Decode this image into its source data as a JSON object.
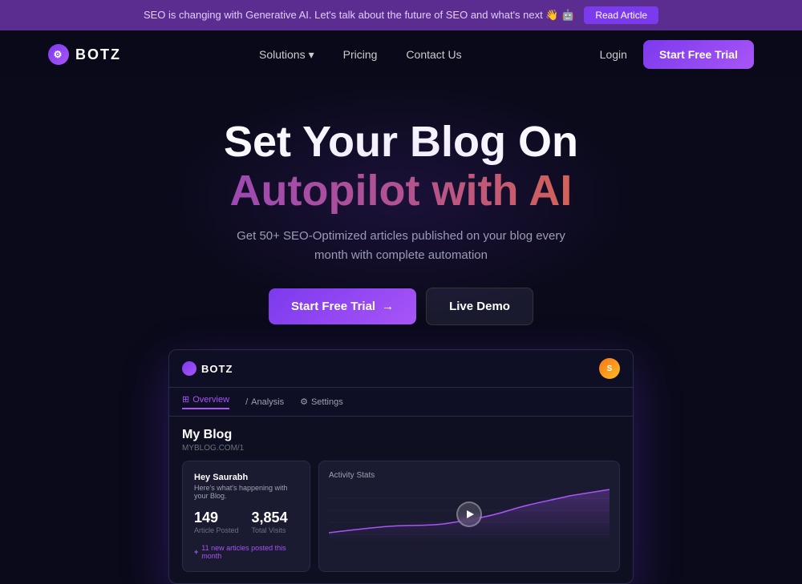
{
  "announcement": {
    "text": "SEO is changing with Generative AI. Let's talk about the future of SEO and what's next 👋 🤖",
    "cta_label": "Read Article"
  },
  "navbar": {
    "logo_text": "BOTZ",
    "nav_links": [
      {
        "label": "Solutions",
        "has_dropdown": true
      },
      {
        "label": "Pricing"
      },
      {
        "label": "Contact Us"
      },
      {
        "label": "Login"
      }
    ],
    "cta_label": "Start Free Trial"
  },
  "hero": {
    "title_line1": "Set Your Blog On",
    "title_line2": "Autopilot with AI",
    "subtitle": "Get 50+ SEO-Optimized articles published on your blog every month with complete automation",
    "btn_primary": "Start Free Trial",
    "btn_secondary": "Live Demo"
  },
  "dashboard": {
    "logo_text": "BOTZ",
    "nav_items": [
      {
        "label": "Overview",
        "active": true
      },
      {
        "label": "Analysis"
      },
      {
        "label": "Settings"
      }
    ],
    "blog_title": "My Blog",
    "blog_url": "MYBLOG.COM/1",
    "greeting": "Hey Saurabh",
    "greeting_desc": "Here's what's happening with your Blog.",
    "articles_posted": "149",
    "articles_label": "Article Posted",
    "total_visits": "3,854",
    "visits_label": "Total Visits",
    "badge_text": "11 new articles posted this month",
    "activity_title": "Activity Stats"
  }
}
